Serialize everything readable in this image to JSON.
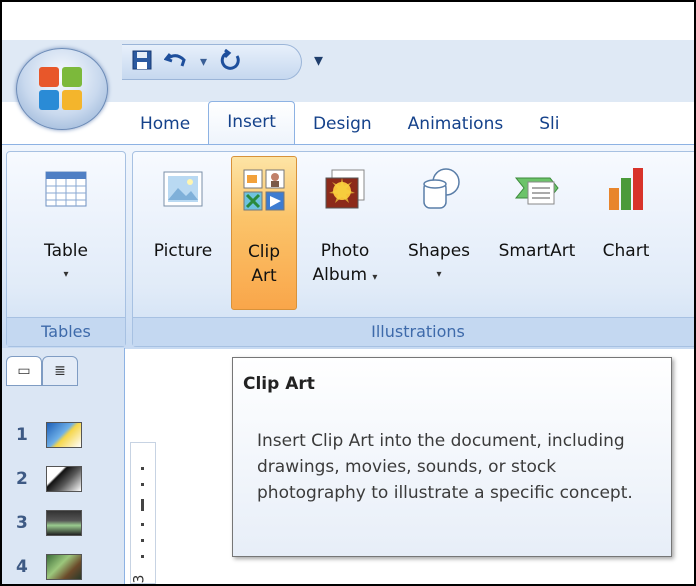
{
  "quick_access": {
    "save_icon": "save-icon",
    "undo_icon": "undo-icon",
    "redo_icon": "redo-icon",
    "customize_glyph": "▾"
  },
  "ribbon_tabs": [
    {
      "label": "Home",
      "active": false
    },
    {
      "label": "Insert",
      "active": true
    },
    {
      "label": "Design",
      "active": false
    },
    {
      "label": "Animations",
      "active": false
    },
    {
      "label": "Sli",
      "active": false
    }
  ],
  "groups": {
    "tables": {
      "label": "Tables",
      "table_button": {
        "label": "Table",
        "dropdown": "▾",
        "icon": "table-icon"
      }
    },
    "illustrations": {
      "label": "Illustrations",
      "picture": {
        "label": "Picture",
        "icon": "picture-icon"
      },
      "clip_art": {
        "label_line1": "Clip",
        "label_line2": "Art",
        "icon": "clip-art-icon"
      },
      "photo_album": {
        "label_line1": "Photo",
        "label_line2": "Album",
        "dropdown": "▾",
        "icon": "photo-album-icon"
      },
      "shapes": {
        "label": "Shapes",
        "dropdown": "▾",
        "icon": "shapes-icon"
      },
      "smartart": {
        "label": "SmartArt",
        "icon": "smartart-icon"
      },
      "chart": {
        "label": "Chart",
        "icon": "chart-icon"
      }
    }
  },
  "slides_pane": {
    "slides": [
      {
        "number": "1"
      },
      {
        "number": "2"
      },
      {
        "number": "3"
      },
      {
        "number": "4"
      }
    ]
  },
  "ruler": {
    "label": "3"
  },
  "tooltip": {
    "title": "Clip Art",
    "body": "Insert Clip Art into the document, including drawings, movies, sounds, or stock photography to illustrate a specific concept."
  },
  "colors": {
    "ribbon_bg": "#dce8f7",
    "hot_button": "#fbc46a",
    "tab_text": "#15428b"
  }
}
